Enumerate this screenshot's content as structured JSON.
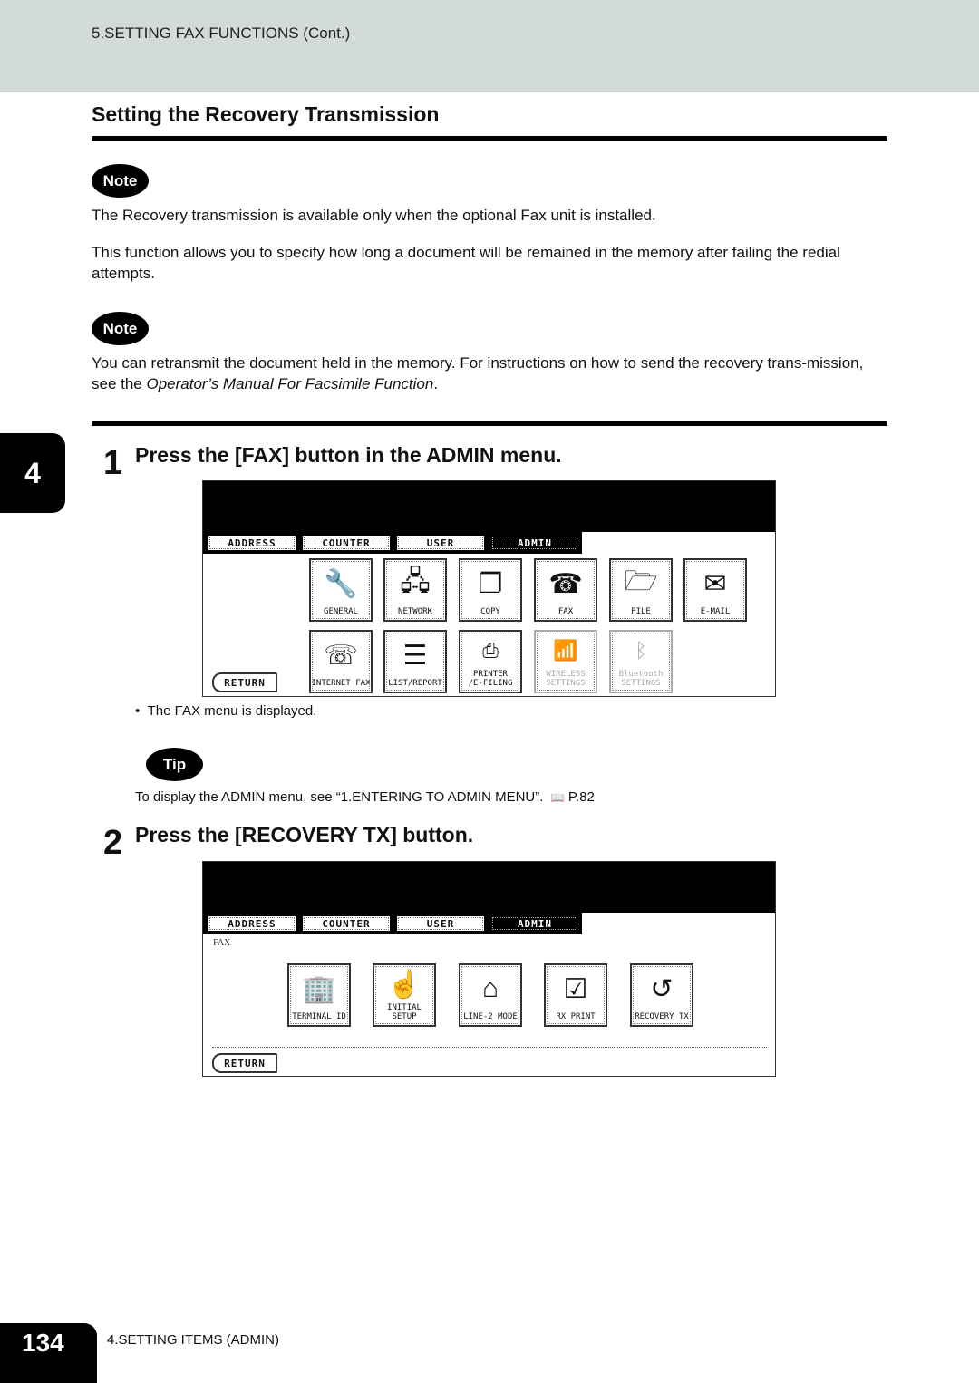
{
  "header": {
    "running_title": "5.SETTING FAX FUNCTIONS (Cont.)"
  },
  "section": {
    "title": "Setting the Recovery Transmission"
  },
  "notes": [
    {
      "badge": "Note",
      "text": "The Recovery transmission is available only when the optional Fax unit is installed."
    },
    {
      "badge": "Note",
      "text_before": "You can retransmit the document held in the memory.  For instructions on how to send the recovery trans-mission, see the ",
      "text_italic": "Operator’s Manual For Facsimile Function",
      "text_after": "."
    }
  ],
  "description": "This function allows you to specify how long a document will be remained in the memory after failing the redial attempts.",
  "chapter_tab": "4",
  "steps": [
    {
      "number": "1",
      "title": "Press the [FAX] button in the ADMIN menu.",
      "screen": {
        "tabs": [
          "ADDRESS",
          "COUNTER",
          "USER",
          "ADMIN"
        ],
        "active_tab": "ADMIN",
        "buttons": [
          {
            "label": "GENERAL",
            "icon": "wrench-copier-icon",
            "enabled": true
          },
          {
            "label": "NETWORK",
            "icon": "wrench-network-icon",
            "enabled": true
          },
          {
            "label": "COPY",
            "icon": "wrench-copy-icon",
            "enabled": true
          },
          {
            "label": "FAX",
            "icon": "wrench-fax-icon",
            "enabled": true
          },
          {
            "label": "FILE",
            "icon": "wrench-folder-icon",
            "enabled": true
          },
          {
            "label": "E-MAIL",
            "icon": "wrench-envelope-icon",
            "enabled": true
          },
          {
            "label": "INTERNET FAX",
            "icon": "wrench-ifax-icon",
            "enabled": true
          },
          {
            "label": "LIST/REPORT",
            "icon": "list-report-icon",
            "enabled": true
          },
          {
            "label": "PRINTER\n/E-FILING",
            "icon": "wrench-printer-icon",
            "enabled": true
          },
          {
            "label": "WIRELESS\nSETTINGS",
            "icon": "wrench-wireless-icon",
            "enabled": false
          },
          {
            "label": "Bluetooth\nSETTINGS",
            "icon": "wrench-bluetooth-icon",
            "enabled": false
          }
        ],
        "return_label": "RETURN"
      },
      "bullet": "The FAX menu is displayed."
    },
    {
      "number": "2",
      "title": "Press the [RECOVERY TX] button.",
      "screen": {
        "tabs": [
          "ADDRESS",
          "COUNTER",
          "USER",
          "ADMIN"
        ],
        "active_tab": "ADMIN",
        "breadcrumb": "FAX",
        "buttons": [
          {
            "label": "TERMINAL ID",
            "icon": "terminal-id-icon",
            "enabled": true
          },
          {
            "label": "INITIAL SETUP",
            "icon": "initial-setup-icon",
            "enabled": true
          },
          {
            "label": "LINE-2 MODE",
            "icon": "line2-mode-icon",
            "enabled": true
          },
          {
            "label": "RX PRINT",
            "icon": "rx-print-icon",
            "enabled": true
          },
          {
            "label": "RECOVERY TX",
            "icon": "recovery-tx-icon",
            "enabled": true
          }
        ],
        "return_label": "RETURN"
      }
    }
  ],
  "tip": {
    "badge": "Tip",
    "text": "To display the ADMIN menu, see “1.ENTERING TO ADMIN MENU”.",
    "book_icon": "📖",
    "page_ref": "P.82"
  },
  "footer": {
    "page_number": "134",
    "chapter_title": "4.SETTING ITEMS (ADMIN)"
  }
}
